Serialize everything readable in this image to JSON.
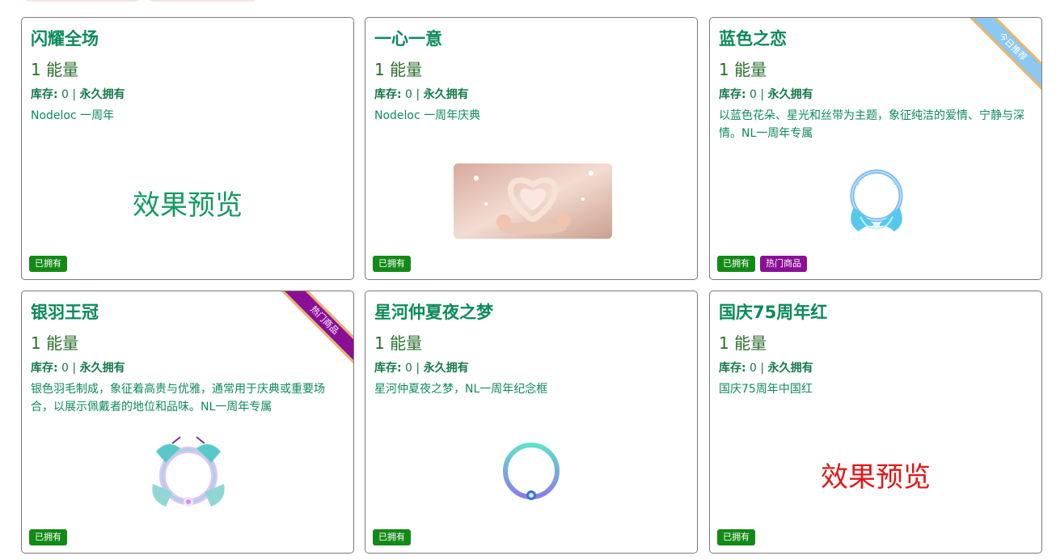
{
  "colors": {
    "title": "#0b8a5c",
    "price": "#2a6e2a",
    "owned_badge": "#138a16",
    "hot_badge": "#8a0f96",
    "ribbon_blue": "#8cc8f0",
    "ribbon_purple": "#8a0f96",
    "preview_green": "#159a63",
    "preview_red": "#e01818"
  },
  "cards": [
    {
      "title": "闪耀全场",
      "price": "1 能量",
      "stock_label": "库存:",
      "stock_value": " 0 | ",
      "ownership": "永久拥有",
      "desc": "Nodeloc 一周年",
      "preview_text": "效果预览",
      "badges": [
        "已拥有"
      ]
    },
    {
      "title": "一心一意",
      "price": "1 能量",
      "stock_label": "库存:",
      "stock_value": " 0 | ",
      "ownership": "永久拥有",
      "desc": "Nodeloc 一周年庆典",
      "image_icon": "heart-arch-image",
      "badges": [
        "已拥有"
      ]
    },
    {
      "title": "蓝色之恋",
      "price": "1 能量",
      "stock_label": "库存:",
      "stock_value": " 0 | ",
      "ownership": "永久拥有",
      "desc": "以蓝色花朵、星光和丝带为主题，象征纯洁的爱情、宁静与深情。NL一周年专属",
      "image_icon": "blue-wing-frame-image",
      "badges": [
        "已拥有",
        "热门商品"
      ],
      "ribbon": "今日推荐"
    },
    {
      "title": "银羽王冠",
      "price": "1 能量",
      "stock_label": "库存:",
      "stock_value": " 0 | ",
      "ownership": "永久拥有",
      "desc": "银色羽毛制成，象征着高贵与优雅，通常用于庆典或重要场合，以展示佩戴者的地位和品味。NL一周年专属",
      "image_icon": "silver-feather-crown-image",
      "badges": [
        "已拥有"
      ],
      "ribbon": "热门商品"
    },
    {
      "title": "星河仲夏夜之梦",
      "price": "1 能量",
      "stock_label": "库存:",
      "stock_value": " 0 | ",
      "ownership": "永久拥有",
      "desc": "星河仲夏夜之梦，NL一周年纪念框",
      "image_icon": "galaxy-ring-frame-image",
      "badges": [
        "已拥有"
      ]
    },
    {
      "title": "国庆75周年红",
      "price": "1 能量",
      "stock_label": "库存:",
      "stock_value": " 0 | ",
      "ownership": "永久拥有",
      "desc": "国庆75周年中国红",
      "preview_text": "效果预览",
      "badges": [
        "已拥有"
      ]
    }
  ]
}
